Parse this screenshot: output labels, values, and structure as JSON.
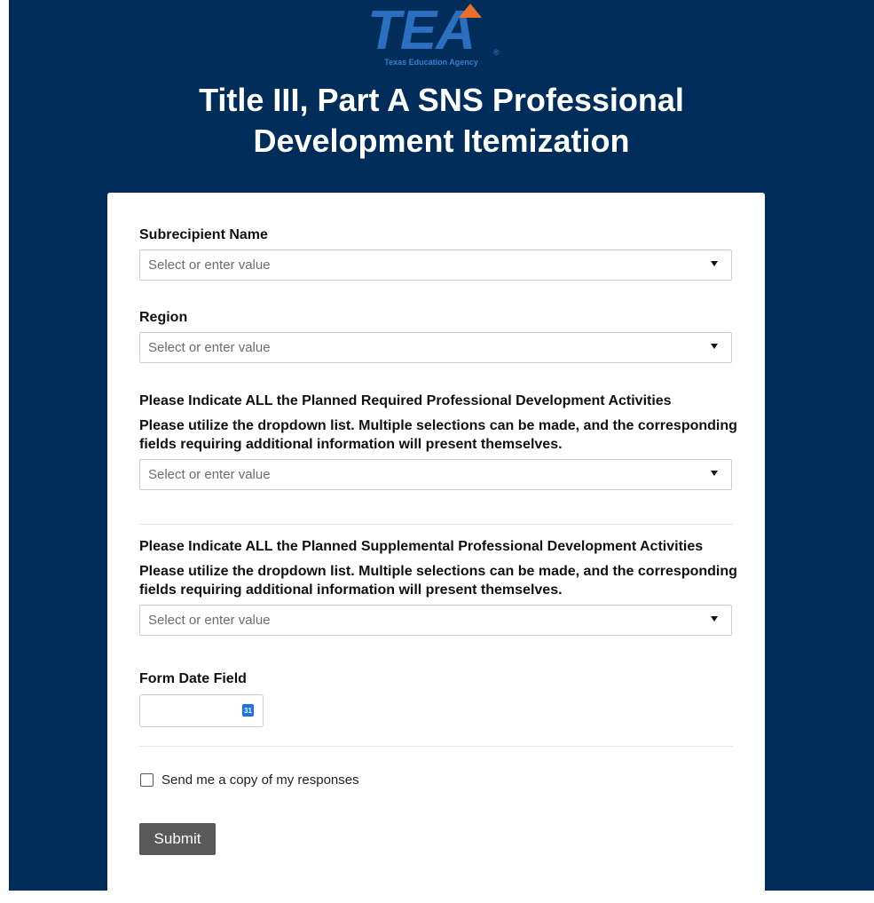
{
  "logo": {
    "text": "TEA",
    "subtitle": "Texas Education Agency",
    "registered": "®"
  },
  "page_title": "Title III, Part A SNS Professional Development Itemization",
  "form": {
    "fields": [
      {
        "label": "Subrecipient Name",
        "placeholder": "Select or enter value"
      },
      {
        "label": "Region",
        "placeholder": "Select or enter value"
      },
      {
        "label": "Please Indicate ALL the Planned Required Professional Development Activities",
        "description": "Please utilize the dropdown list. Multiple selections can be made, and the corresponding fields requiring additional information will present themselves.",
        "placeholder": "Select or enter value"
      },
      {
        "label": "Please Indicate ALL the Planned Supplemental Professional Development Activities",
        "description": "Please utilize the dropdown list. Multiple selections can be made, and the corresponding fields requiring additional information will present themselves.",
        "placeholder": "Select or enter value"
      }
    ],
    "date_field": {
      "label": "Form Date Field",
      "value": "",
      "calendar_icon_text": "31"
    },
    "copy_checkbox": {
      "label": "Send me a copy of my responses",
      "checked": false
    },
    "submit_label": "Submit"
  },
  "colors": {
    "background": "#002d59",
    "logo_blue": "#2a6fc0",
    "logo_accent": "#e8702a",
    "button": "#595959"
  }
}
